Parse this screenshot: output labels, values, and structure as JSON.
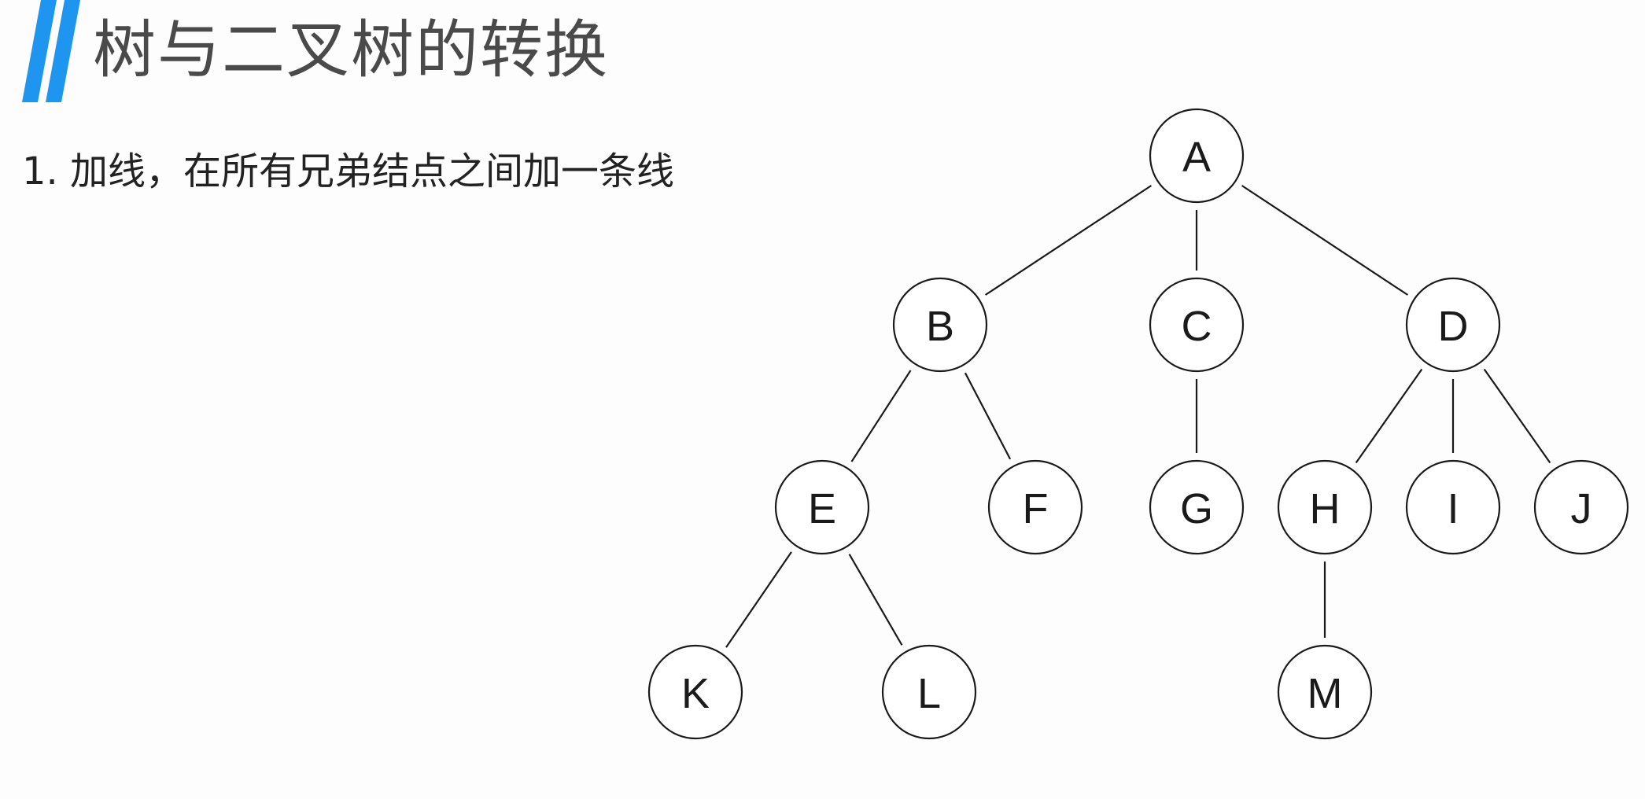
{
  "slide": {
    "title": "树与二叉树的转换",
    "step": "1. 加线，在所有兄弟结点之间加一条线",
    "accent_color": "#1e96f0"
  },
  "tree": {
    "nodes": [
      "A",
      "B",
      "C",
      "D",
      "E",
      "F",
      "G",
      "H",
      "I",
      "J",
      "K",
      "L",
      "M"
    ],
    "edges": [
      [
        "A",
        "B"
      ],
      [
        "A",
        "C"
      ],
      [
        "A",
        "D"
      ],
      [
        "B",
        "E"
      ],
      [
        "B",
        "F"
      ],
      [
        "C",
        "G"
      ],
      [
        "D",
        "H"
      ],
      [
        "D",
        "I"
      ],
      [
        "D",
        "J"
      ],
      [
        "E",
        "K"
      ],
      [
        "E",
        "L"
      ],
      [
        "H",
        "M"
      ]
    ]
  }
}
